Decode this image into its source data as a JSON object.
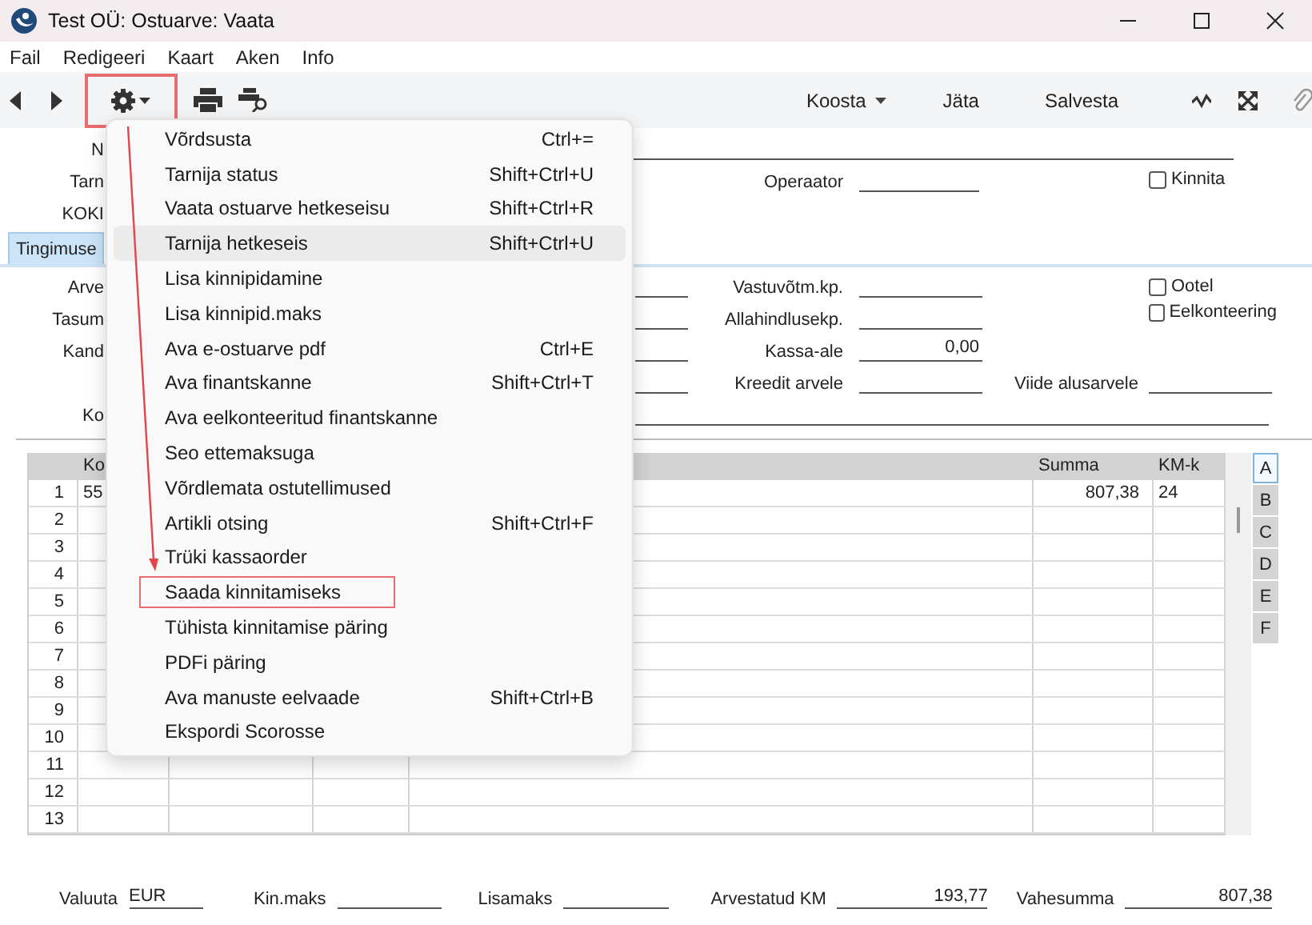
{
  "window": {
    "title": "Test OÜ: Ostuarve: Vaata"
  },
  "menu_bar": [
    "Fail",
    "Redigeeri",
    "Kaart",
    "Aken",
    "Info"
  ],
  "toolbar": {
    "actions_button": {
      "annotated": true
    },
    "buttons": [
      {
        "label": "Koosta",
        "kind": "dropdown"
      },
      {
        "label": "Jäta",
        "kind": "plain"
      },
      {
        "label": "Salvesta",
        "kind": "plain"
      }
    ]
  },
  "header": {
    "row_labels": [
      "N",
      "Tarn",
      "KOKI"
    ],
    "operator_label": "Operaator",
    "checkbox": {
      "label": "Kinnita",
      "checked": false
    }
  },
  "tabs": [
    {
      "label": "Tingimuse",
      "selected": true
    }
  ],
  "terms": {
    "row_labels": [
      "Arve",
      "Tasum",
      "Kand"
    ],
    "comment_label": "Ko",
    "fields": [
      {
        "label": "Vastuvõtm.kp."
      },
      {
        "label": "Allahindlusekp."
      },
      {
        "label": "Kassa-ale",
        "value": "0,00"
      },
      {
        "label": "Kreedit arvele"
      }
    ],
    "reference": {
      "label": "Viide alusarvele"
    },
    "checkboxes": [
      {
        "label": "Ootel",
        "checked": false
      },
      {
        "label": "Eelkonteering",
        "checked": false
      }
    ]
  },
  "table": {
    "columns": [
      {},
      {
        "header": "Ko"
      },
      {},
      {},
      {},
      {
        "header": "Summa"
      },
      {
        "header": "KM-k"
      }
    ],
    "rows": [
      {
        "number": "1",
        "code": "55",
        "sum": "807,38",
        "vat": "24"
      },
      {
        "number": "2"
      },
      {
        "number": "3"
      },
      {
        "number": "4"
      },
      {
        "number": "5"
      },
      {
        "number": "6"
      },
      {
        "number": "7"
      },
      {
        "number": "8"
      },
      {
        "number": "9"
      },
      {
        "number": "10"
      },
      {
        "number": "11"
      },
      {
        "number": "12"
      },
      {
        "number": "13"
      }
    ]
  },
  "side_tabs": [
    {
      "label": "A",
      "selected": true
    },
    {
      "label": "B",
      "selected": false
    },
    {
      "label": "C",
      "selected": false
    },
    {
      "label": "D",
      "selected": false
    },
    {
      "label": "E",
      "selected": false
    },
    {
      "label": "F",
      "selected": false
    }
  ],
  "totals": [
    {
      "label": "Valuuta",
      "value": "EUR",
      "kind": "text"
    },
    {
      "label": "Kin.maks",
      "kind": "amount"
    },
    {
      "label": "Lisamaks",
      "kind": "amount"
    },
    {
      "label": "Arvestatud KM",
      "value": "193,77",
      "kind": "amount"
    },
    {
      "label": "Vahesumma",
      "value": "807,38",
      "kind": "amount"
    }
  ],
  "context_menu": {
    "items": [
      {
        "label": "Võrdsusta",
        "shortcut": "Ctrl+=",
        "selected": false,
        "annotated": false
      },
      {
        "label": "Tarnija status",
        "shortcut": "Shift+Ctrl+U",
        "selected": false,
        "annotated": false
      },
      {
        "label": "Vaata ostuarve hetkeseisu",
        "shortcut": "Shift+Ctrl+R",
        "selected": false,
        "annotated": false
      },
      {
        "label": "Tarnija hetkeseis",
        "shortcut": "Shift+Ctrl+U",
        "selected": true,
        "annotated": false
      },
      {
        "label": "Lisa kinnipidamine",
        "selected": false,
        "annotated": false
      },
      {
        "label": "Lisa kinnipid.maks",
        "selected": false,
        "annotated": false
      },
      {
        "label": "Ava e-ostuarve pdf",
        "shortcut": "Ctrl+E",
        "selected": false,
        "annotated": false
      },
      {
        "label": "Ava finantskanne",
        "shortcut": "Shift+Ctrl+T",
        "selected": false,
        "annotated": false
      },
      {
        "label": "Ava eelkonteeritud finantskanne",
        "selected": false,
        "annotated": false
      },
      {
        "label": "Seo ettemaksuga",
        "selected": false,
        "annotated": false
      },
      {
        "label": "Võrdlemata ostutellimused",
        "selected": false,
        "annotated": false
      },
      {
        "label": "Artikli otsing",
        "shortcut": "Shift+Ctrl+F",
        "selected": false,
        "annotated": false
      },
      {
        "label": "Trüki kassaorder",
        "selected": false,
        "annotated": false
      },
      {
        "label": "Saada kinnitamiseks",
        "selected": false,
        "annotated": true
      },
      {
        "label": "Tühista kinnitamise päring",
        "selected": false,
        "annotated": false
      },
      {
        "label": "PDFi päring",
        "selected": false,
        "annotated": false
      },
      {
        "label": "Ava manuste eelvaade",
        "shortcut": "Shift+Ctrl+B",
        "selected": false,
        "annotated": false
      },
      {
        "label": "Ekspordi Scorosse",
        "selected": false,
        "annotated": false
      }
    ]
  }
}
